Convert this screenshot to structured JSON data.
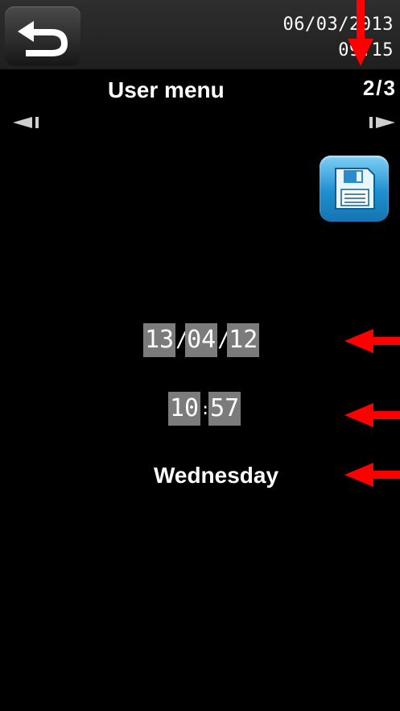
{
  "header": {
    "date": "06/03/2013",
    "time": "09:15",
    "title": "User menu",
    "page_indicator": "2/3"
  },
  "icons": {
    "back": "back-arrow-icon",
    "save": "floppy-disk-icon",
    "prev": "chevron-left-icon",
    "next": "chevron-right-icon"
  },
  "settings": {
    "date": {
      "day": "13",
      "month": "04",
      "year": "12",
      "separator": "/"
    },
    "time": {
      "hours": "10",
      "minutes": "57",
      "separator": ":"
    },
    "weekday": "Wednesday"
  },
  "colors": {
    "background": "#000000",
    "field_bg": "#7b7b7b",
    "annotation_red": "#ff0000",
    "save_blue": "#1f8fd0"
  }
}
